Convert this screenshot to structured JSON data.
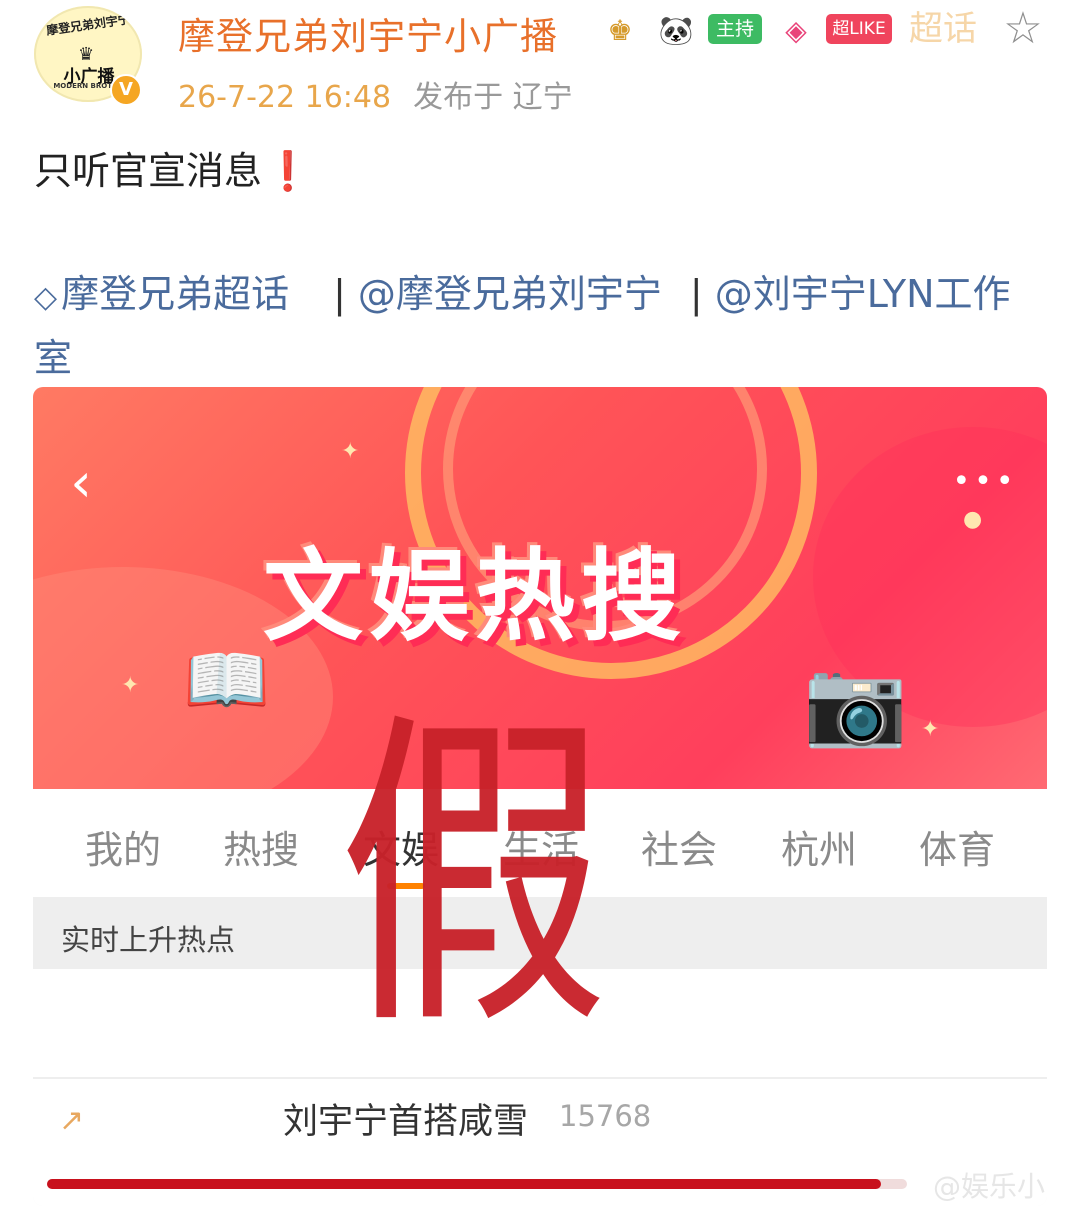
{
  "author": {
    "avatar_text_top": "摩登兄弟刘宇宁",
    "avatar_text_main": "小广播",
    "avatar_text_sub": "MODERN BROTHE",
    "name": "摩登兄弟刘宇宁小广播",
    "verified_icon": "verified-v-icon",
    "badges": {
      "crown_icon": "crown-icon",
      "panda_icon": "panda-icon",
      "host_label": "主持",
      "diamond_icon": "diamond-icon",
      "like_label": "超LIKE",
      "topic_label": "超话"
    },
    "star_icon": "star-outline-icon"
  },
  "meta": {
    "time": "26-7-22 16:48",
    "location": "发布于 辽宁"
  },
  "post": {
    "text": "只听官宣消息",
    "emoji": "❗",
    "tags": [
      {
        "icon": "supertopic-diamond-icon",
        "label": "摩登兄弟超话"
      },
      {
        "label": "@摩登兄弟刘宇宁"
      },
      {
        "label": "@刘宇宁LYN工作室"
      }
    ],
    "separator": "|"
  },
  "screenshot": {
    "banner_title": "文娱热搜",
    "back_icon": "chevron-left-icon",
    "more_icon": "more-dots-icon",
    "tabs": [
      "我的",
      "热搜",
      "文娱",
      "生活",
      "社会",
      "杭州",
      "体育"
    ],
    "active_tab": "文娱",
    "section_label": "实时上升热点",
    "items": [
      {
        "trend_icon": "trend-up-arrow-icon",
        "title": "刘宇宁首搭咸雪",
        "count": "15768",
        "progress": 0.97
      }
    ],
    "watermark": "@娱乐小喇叭"
  },
  "overlay": {
    "stamp_text": "假"
  },
  "colors": {
    "username": "#e8702a",
    "time": "#e8a64b",
    "link": "#4a6b9c",
    "banner_red": "#ff4f5c",
    "stamp_red": "#c8222a",
    "tab_active": "#ff8200"
  }
}
